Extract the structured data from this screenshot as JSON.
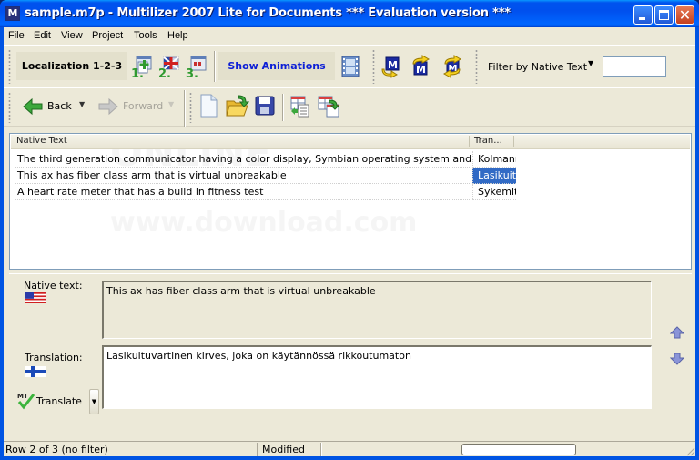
{
  "window": {
    "title": "sample.m7p - Multilizer 2007 Lite for Documents *** Evaluation version ***",
    "app_icon_letter": "M",
    "controls": {
      "minimize": "minimize",
      "maximize": "maximize",
      "close": "✕"
    }
  },
  "menu": {
    "items": [
      {
        "label": "File"
      },
      {
        "label": "Edit"
      },
      {
        "label": "View"
      },
      {
        "label": "Project"
      },
      {
        "label": "Tools"
      },
      {
        "label": "Help"
      }
    ]
  },
  "toolbar1": {
    "localization_label": "Localization 1-2-3",
    "steps": [
      {
        "name": "step-1-create-project",
        "number": "1."
      },
      {
        "name": "step-2-translate",
        "number": "2."
      },
      {
        "name": "step-3-build",
        "number": "3."
      }
    ],
    "show_animations_label": "Show Animations",
    "filter_label": "Filter by Native Text",
    "filter_value": ""
  },
  "toolbar2": {
    "back_label": "Back",
    "forward_label": "Forward"
  },
  "grid": {
    "columns": [
      "Native Text",
      "Tran..."
    ],
    "rows": [
      {
        "native": "The third generation communicator having a color display, Symbian operating system and Java",
        "translation": "Kolmanr",
        "selected": false
      },
      {
        "native": "This ax has fiber class arm that is virtual unbreakable",
        "translation": "Lasikuitu",
        "selected": true
      },
      {
        "native": "A heart rate meter that has a build in fitness test",
        "translation": "Sykemit",
        "selected": false
      }
    ],
    "selected_color": "#316ac5"
  },
  "editor": {
    "native_label": "Native text:",
    "native_text": "This ax has fiber class arm that is virtual unbreakable",
    "translation_label": "Translation:",
    "translation_text": "Lasikuituvartinen kirves, joka on käytännössä rikkoutumaton",
    "translate_label": "Translate",
    "translate_icon_text": "MT"
  },
  "status": {
    "row_info": "Row 2 of 3 (no filter)",
    "state": "Modified",
    "progress": 0
  }
}
